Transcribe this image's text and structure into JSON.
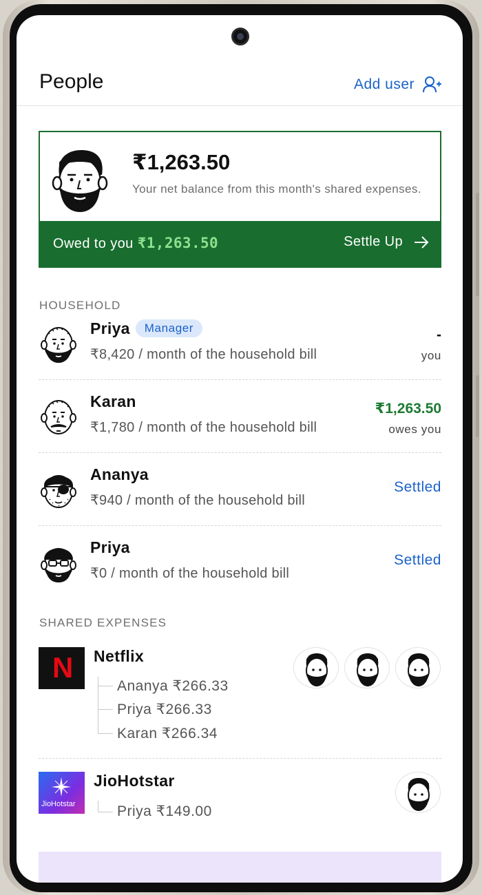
{
  "header": {
    "title": "People",
    "add_user_label": "Add user"
  },
  "balance": {
    "amount": "₹1,263.50",
    "description": "Your net balance from this month's shared expenses.",
    "owed_label": "Owed to you",
    "owed_amount": "₹1,263.50",
    "settle_label": "Settle Up"
  },
  "household": {
    "label": "HOUSEHOLD",
    "members": [
      {
        "name": "Priya",
        "badge": "Manager",
        "bill": "₹8,420 / month of the household bill",
        "amount": "-",
        "sub": "you"
      },
      {
        "name": "Karan",
        "bill": "₹1,780 / month of the household bill",
        "amount": "₹1,263.50",
        "sub": "owes you"
      },
      {
        "name": "Ananya",
        "bill": "₹940 / month of the household bill",
        "status": "Settled"
      },
      {
        "name": "Priya",
        "bill": "₹0 / month of the household bill",
        "status": "Settled"
      }
    ]
  },
  "shared": {
    "label": "SHARED EXPENSES",
    "expenses": [
      {
        "name": "Netflix",
        "logo_text": "N",
        "splits": [
          "Ananya ₹266.33",
          "Priya ₹266.33",
          "Karan ₹266.34"
        ]
      },
      {
        "name": "JioHotstar",
        "logo_text": "JioHotstar",
        "splits": [
          "Priya ₹149.00"
        ]
      }
    ]
  },
  "colors": {
    "accent_green": "#196d2f",
    "light_green": "#8ee08d",
    "link_blue": "#1a62c8",
    "amount_green": "#1e7a34"
  }
}
